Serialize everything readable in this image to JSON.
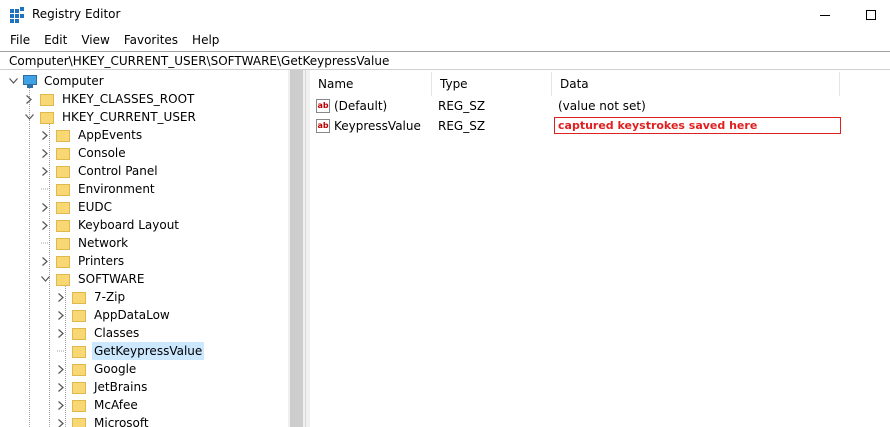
{
  "window": {
    "title": "Registry Editor",
    "minimize_glyph": "",
    "maximize_glyph": ""
  },
  "menu": [
    "File",
    "Edit",
    "View",
    "Favorites",
    "Help"
  ],
  "address": "Computer\\HKEY_CURRENT_USER\\SOFTWARE\\GetKeypressValue",
  "tree": {
    "root": "Computer",
    "hives": [
      "HKEY_CLASSES_ROOT",
      "HKEY_CURRENT_USER"
    ],
    "hkcu_children": [
      "AppEvents",
      "Console",
      "Control Panel",
      "Environment",
      "EUDC",
      "Keyboard Layout",
      "Network",
      "Printers",
      "SOFTWARE"
    ],
    "software_children": [
      "7-Zip",
      "AppDataLow",
      "Classes",
      "GetKeypressValue",
      "Google",
      "JetBrains",
      "McAfee",
      "Microsoft"
    ],
    "selected": "GetKeypressValue"
  },
  "list": {
    "columns": [
      "Name",
      "Type",
      "Data"
    ],
    "rows": [
      {
        "icon": "string-value-icon",
        "icon_text": "ab",
        "name": "(Default)",
        "type": "REG_SZ",
        "data": "(value not set)"
      },
      {
        "icon": "string-value-icon",
        "icon_text": "ab",
        "name": "KeypressValue",
        "type": "REG_SZ",
        "data": "captured keystrokes saved here"
      }
    ]
  },
  "colors": {
    "selection": "#cce8ff",
    "annotation_red": "#e02020",
    "folder": "#f8d775"
  }
}
